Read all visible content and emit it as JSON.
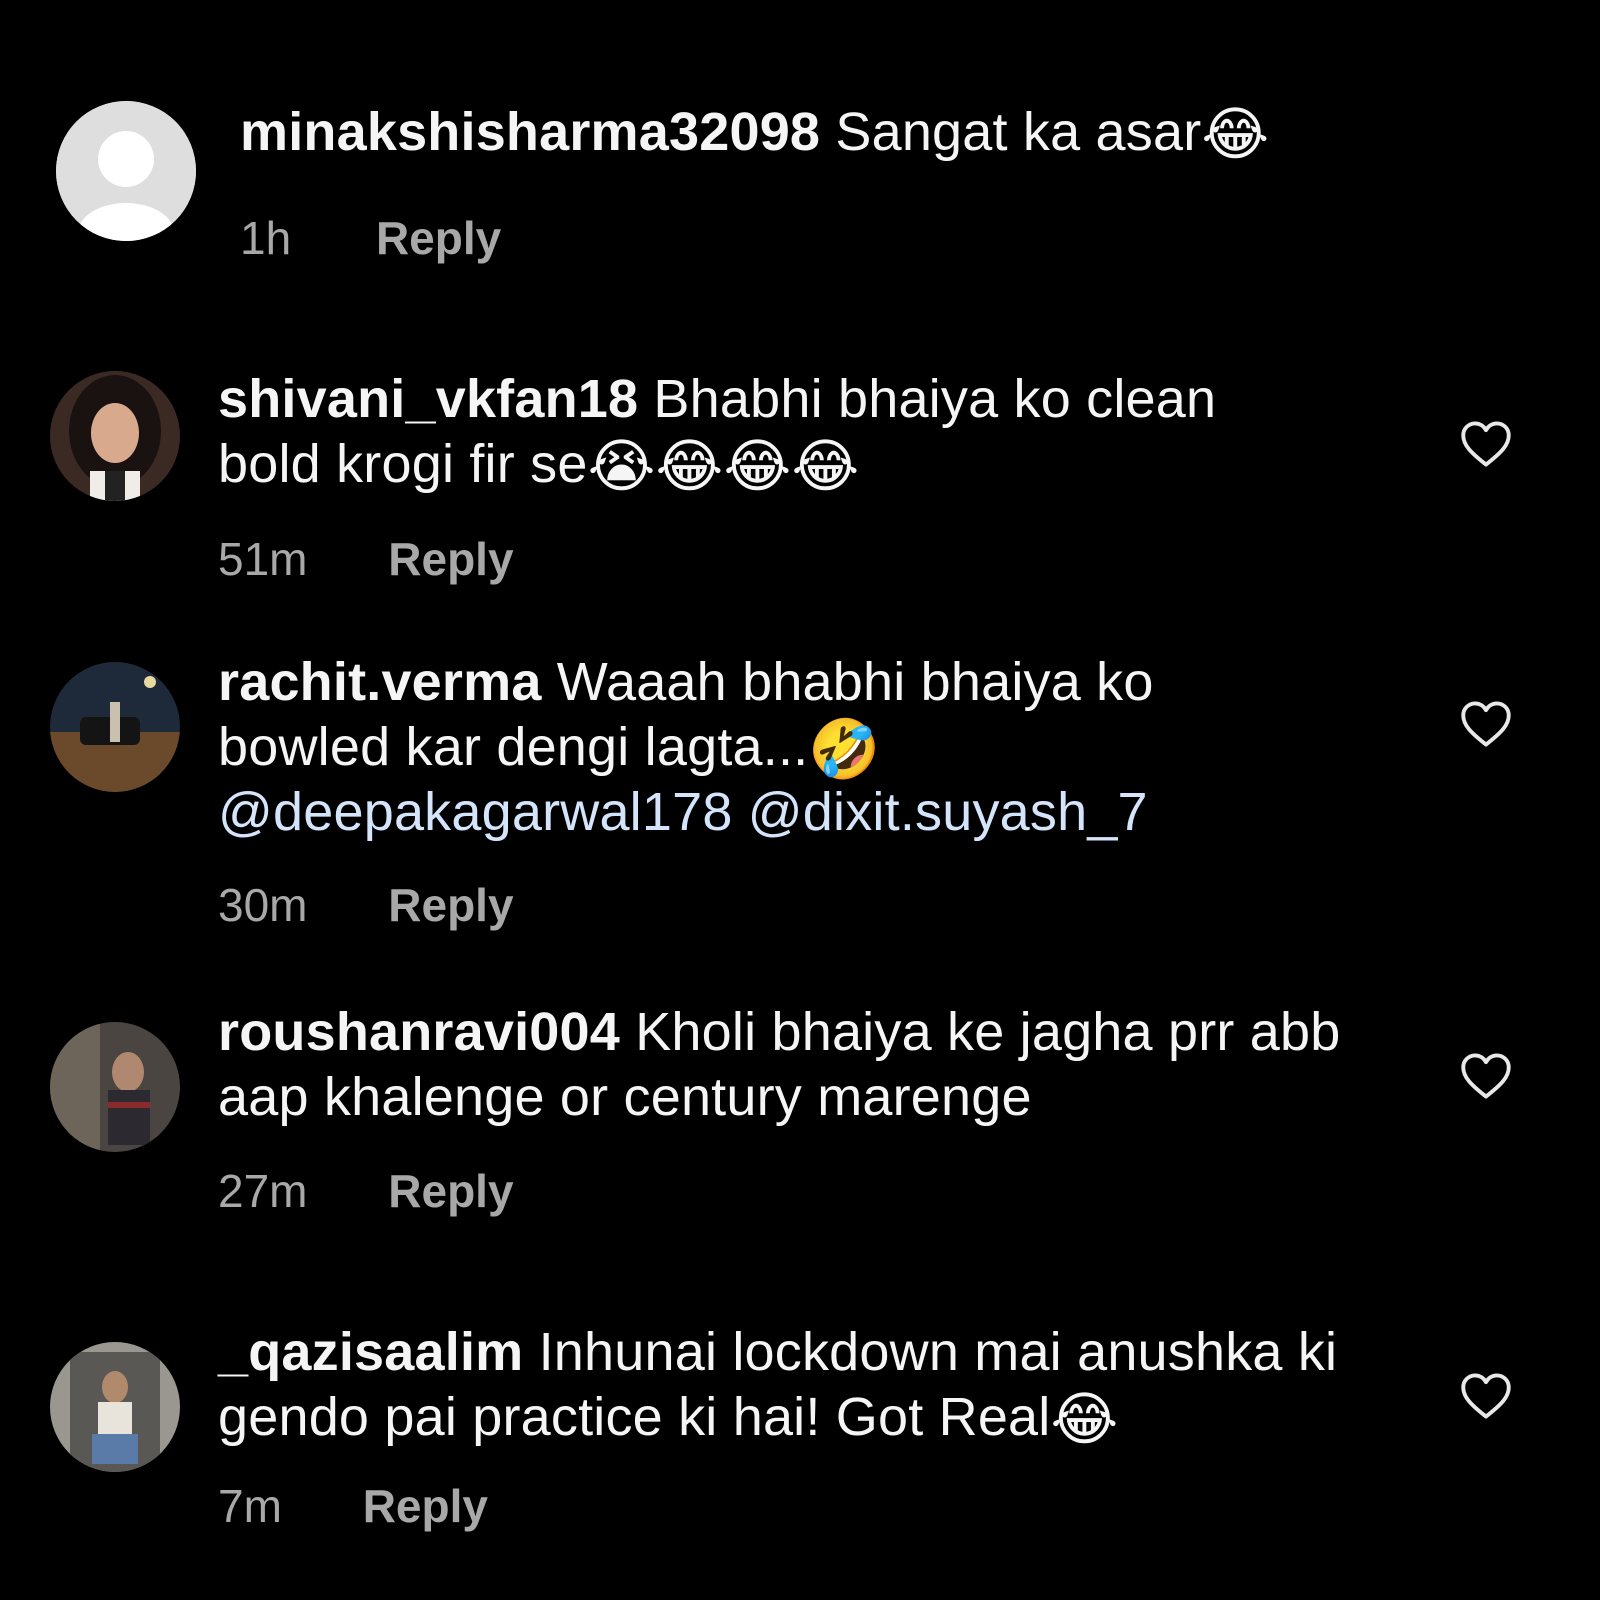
{
  "comments": [
    {
      "username": "minakshisharma32098",
      "text": " Sangat ka asar",
      "emojis": "😂",
      "time": "1h",
      "reply_label": "Reply"
    },
    {
      "username": "shivani_vkfan18",
      "text": " Bhabhi bhaiya ko clean bold krogi fir se",
      "emojis": "😭😂😂😂",
      "time": "51m",
      "reply_label": "Reply"
    },
    {
      "username": "rachit.verma",
      "text": " Waaah bhabhi bhaiya ko bowled kar dengi lagta...",
      "emojis": "🤣",
      "mentions": "@deepakagarwal178 @dixit.suyash_7",
      "time": "30m",
      "reply_label": "Reply"
    },
    {
      "username": "roushanravi004",
      "text": " Kholi bhaiya ke jagha prr abb aap khalenge or century marenge",
      "time": "27m",
      "reply_label": "Reply"
    },
    {
      "username": "_qazisaalim",
      "text": " Inhunai lockdown mai anushka ki gendo pai practice ki hai! Got Real",
      "emojis": "😂",
      "time": "7m",
      "reply_label": "Reply"
    }
  ],
  "icons": {
    "like": "heart-outline-icon",
    "default_avatar": "default-avatar-icon"
  },
  "colors": {
    "background": "#000000",
    "text": "#f5f5f5",
    "secondary": "#a8a8a8",
    "mention": "#d4e4fb"
  }
}
